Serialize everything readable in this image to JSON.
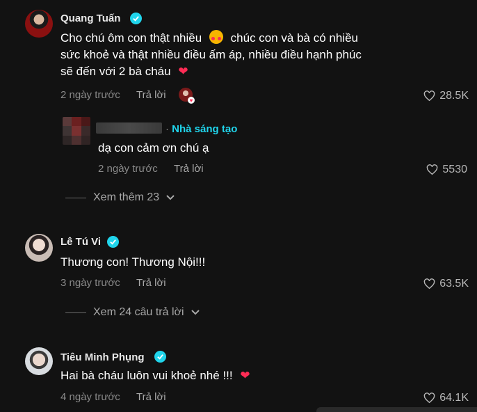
{
  "comments": [
    {
      "author": "Quang Tuấn",
      "text_line1": "Cho chú ôm con thật nhiều",
      "text_line1b": "chúc con và bà có nhiều",
      "text_line2": "sức khoẻ và thật nhiều điều ấm áp, nhiều điều hạnh phúc",
      "text_line3": "sẽ đến với 2 bà cháu",
      "time": "2 ngày trước",
      "reply_label": "Trả lời",
      "likes": "28.5K",
      "reply": {
        "badge": "Nhà sáng tạo",
        "text": "dạ con cảm ơn chú ạ",
        "time": "2 ngày trước",
        "reply_label": "Trả lời",
        "likes": "5530"
      },
      "more_label": "Xem thêm 23"
    },
    {
      "author": "Lê Tú Vi",
      "text": "Thương con! Thương Nội!!!",
      "time": "3 ngày trước",
      "reply_label": "Trả lời",
      "likes": "63.5K",
      "more_label": "Xem 24 câu trả lời"
    },
    {
      "author": "Tiêu Minh Phụng",
      "text": "Hai bà cháu luôn vui khoẻ nhé !!!",
      "time": "4 ngày trước",
      "reply_label": "Trả lời",
      "likes": "64.1K"
    }
  ],
  "colors": {
    "background": "#121212",
    "verified": "#20d5ec",
    "heart": "#fe2c55",
    "creator_badge": "#20d5ec"
  }
}
